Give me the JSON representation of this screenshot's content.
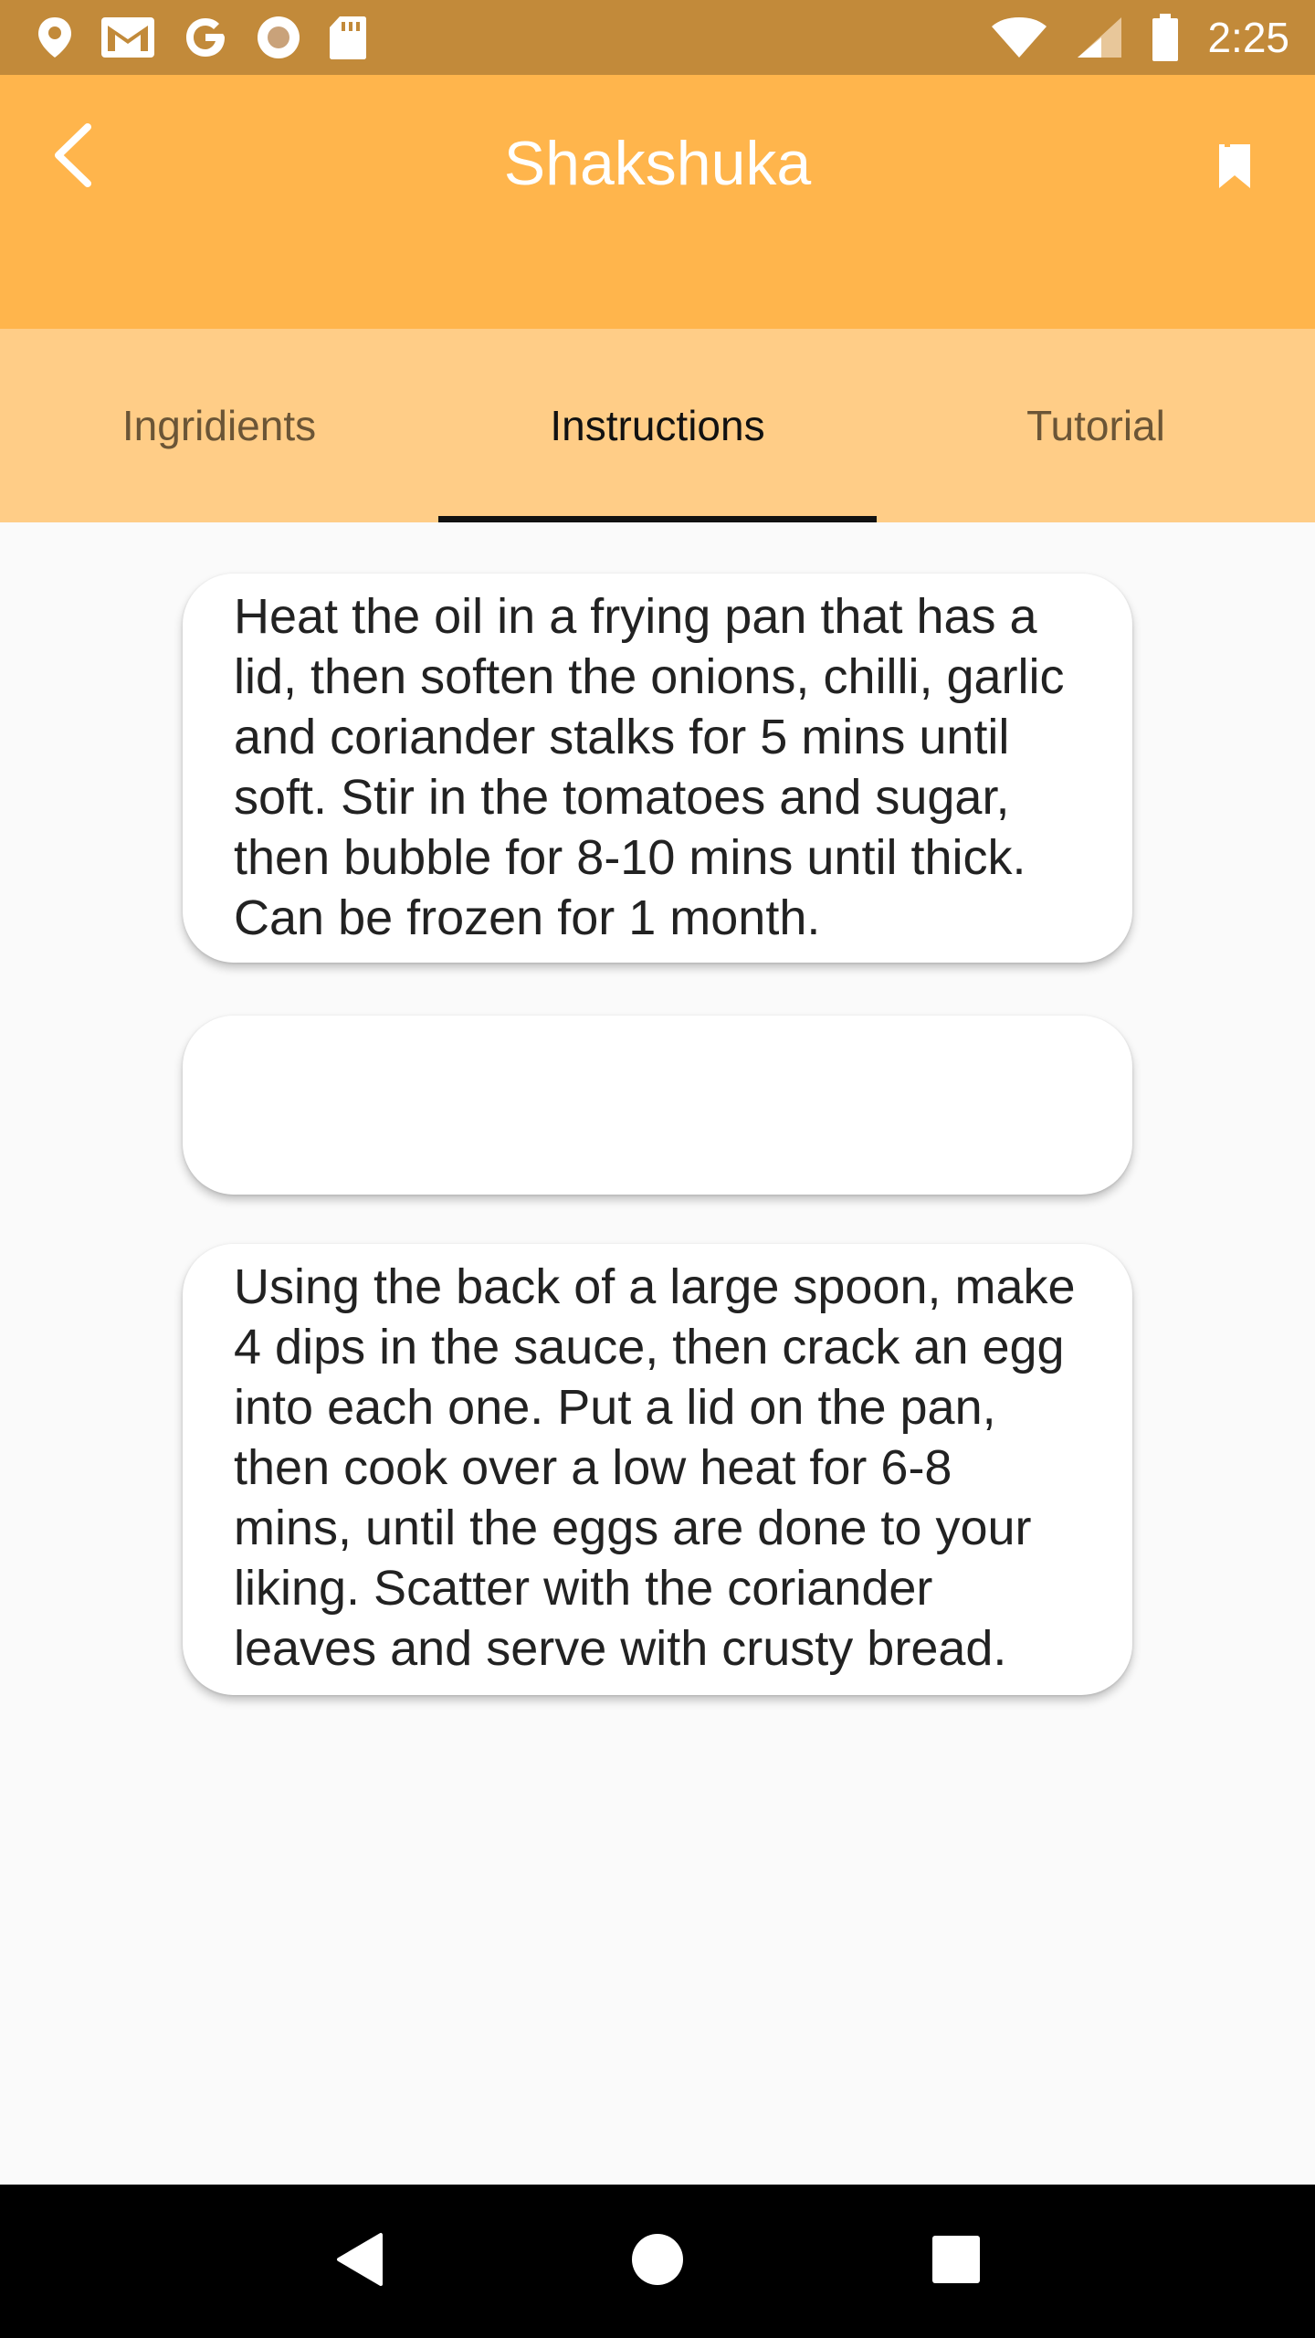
{
  "status_bar": {
    "time": "2:25",
    "left_icons": [
      "location-icon",
      "gmail-icon",
      "google-icon",
      "record-icon",
      "sd-card-icon"
    ],
    "right_icons": [
      "wifi-icon",
      "cell-signal-icon",
      "battery-icon"
    ]
  },
  "app_bar": {
    "title": "Shakshuka",
    "back_icon": "back-arrow-icon",
    "bookmark_icon": "bookmark-icon",
    "background": "#ffb54c"
  },
  "tabs": [
    {
      "label": "Ingridients",
      "active": false
    },
    {
      "label": "Instructions",
      "active": true
    },
    {
      "label": "Tutorial",
      "active": false
    }
  ],
  "instructions": [
    {
      "text": "Heat the oil in a frying pan that has a lid, then soften the onions, chilli, garlic and coriander stalks for 5 mins until soft. Stir in the tomatoes and sugar, then bubble for 8-10 mins until thick. Can be frozen for 1 month."
    },
    {
      "text": ""
    },
    {
      "text": "Using the back of a large spoon, make 4 dips in the sauce, then crack an egg into each one. Put a lid on the pan, then cook over a low heat for 6-8 mins, until the eggs are done to your liking. Scatter with the coriander leaves and serve with crusty bread."
    }
  ],
  "colors": {
    "status_bar": "#c28a3a",
    "tab_bar": "#ffcd87",
    "active_indicator": "#111111"
  }
}
